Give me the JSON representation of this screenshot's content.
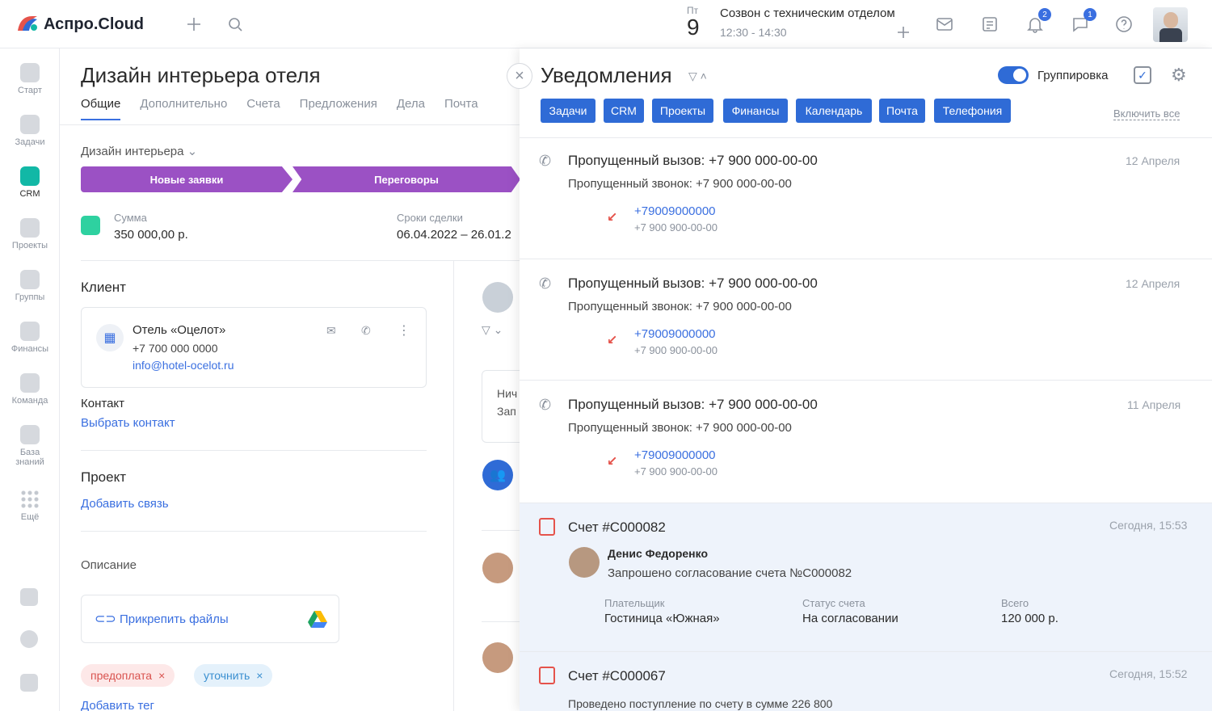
{
  "header": {
    "logo": "Аспро.Cloud",
    "event_day_name": "Пт",
    "event_day_num": "9",
    "event_title": "Созвон с техническим отделом",
    "event_time": "12:30 - 14:30",
    "notif_badge": "2",
    "chat_badge": "1"
  },
  "sidebar": {
    "items": [
      {
        "label": "Старт"
      },
      {
        "label": "Задачи"
      },
      {
        "label": "CRM"
      },
      {
        "label": "Проекты"
      },
      {
        "label": "Группы"
      },
      {
        "label": "Финансы"
      },
      {
        "label": "Команда"
      },
      {
        "label": "База знаний"
      },
      {
        "label": "Ещё"
      }
    ]
  },
  "deal": {
    "title": "Дизайн интерьера отеля",
    "tabs": [
      "Общие",
      "Дополнительно",
      "Счета",
      "Предложения",
      "Дела",
      "Почта"
    ],
    "funnel": "Дизайн интерьера",
    "stages": [
      "Новые заявки",
      "Переговоры"
    ],
    "sum_label": "Сумма",
    "sum_value": "350 000,00 р.",
    "term_label": "Сроки сделки",
    "term_value": "06.04.2022  –  26.01.2",
    "client_h": "Клиент",
    "client_name": "Отель «Оцелот»",
    "client_phone": "+7 700 000 0000",
    "client_email": "info@hotel-ocelot.ru",
    "contact_h": "Контакт",
    "contact_link": "Выбрать контакт",
    "project_h": "Проект",
    "project_link": "Добавить связь",
    "desc_h": "Описание",
    "attach": "Прикрепить файлы",
    "tags": [
      "предоплата",
      "уточнить"
    ],
    "add_tag": "Добавить тег",
    "feed_text1": "Нич",
    "feed_text2": "Зап"
  },
  "notifications": {
    "title": "Уведомления",
    "grouping": "Группировка",
    "enable_all": "Включить все",
    "filters": [
      "Задачи",
      "CRM",
      "Проекты",
      "Финансы",
      "Календарь",
      "Почта",
      "Телефония"
    ],
    "calls": [
      {
        "title": "Пропущенный вызов: +7 900 000-00-00",
        "date": "12 Апреля",
        "sub": "Пропущенный звонок: +7 900 000-00-00",
        "phone": "+79009000000",
        "phone_fmt": "+7 900 900-00-00"
      },
      {
        "title": "Пропущенный вызов: +7 900 000-00-00",
        "date": "12 Апреля",
        "sub": "Пропущенный звонок: +7 900 000-00-00",
        "phone": "+79009000000",
        "phone_fmt": "+7 900 900-00-00"
      },
      {
        "title": "Пропущенный вызов: +7 900 000-00-00",
        "date": "11 Апреля",
        "sub": "Пропущенный звонок: +7 900 000-00-00",
        "phone": "+79009000000",
        "phone_fmt": "+7 900 900-00-00"
      }
    ],
    "invoice1": {
      "title": "Счет #С000082",
      "date": "Сегодня, 15:53",
      "user": "Денис Федоренко",
      "text": "Запрошено согласование счета №С000082",
      "payer_label": "Плательщик",
      "payer": "Гостиница «Южная»",
      "status_label": "Статус счета",
      "status": "На согласовании",
      "total_label": "Всего",
      "total": "120 000 р."
    },
    "invoice2": {
      "title": "Счет #С000067",
      "date": "Сегодня, 15:52",
      "text": "Проведено поступление по счету в сумме 226 800"
    }
  },
  "colors": {
    "accent": "#2f6bd6",
    "pipeline": "#9b51c4",
    "crm": "#12b8a6",
    "missed": "#e5534b"
  }
}
